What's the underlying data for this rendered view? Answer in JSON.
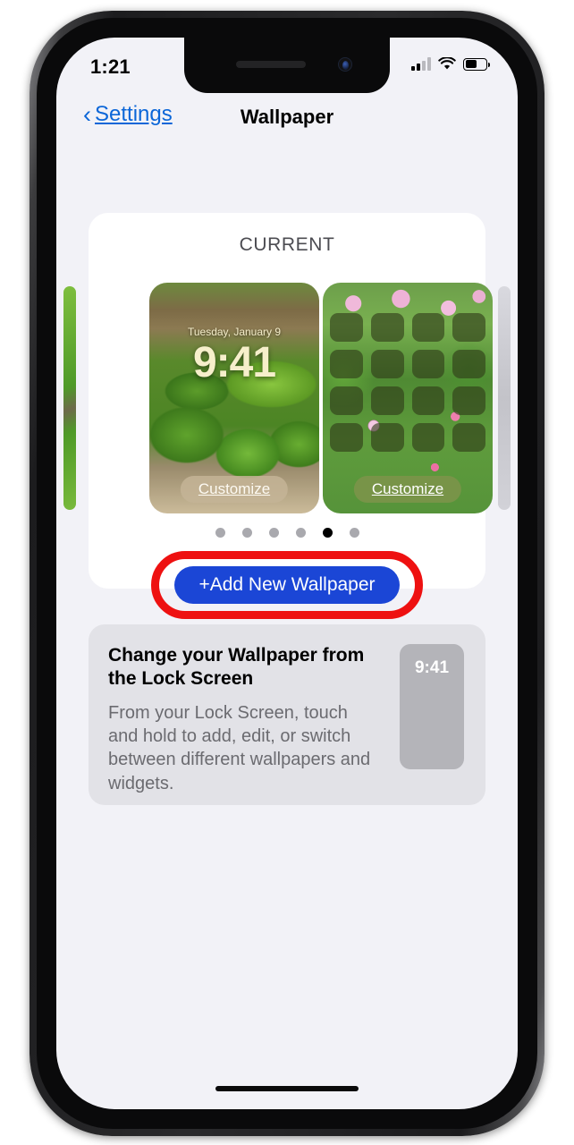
{
  "status_bar": {
    "time": "1:21",
    "cellular_bars_filled": 2,
    "cellular_bars_total": 4,
    "wifi_icon": "wifi-icon",
    "battery_level_percent": 48
  },
  "nav": {
    "back_label": "Settings",
    "back_icon": "chevron-left-icon",
    "title": "Wallpaper"
  },
  "current_section": {
    "label": "CURRENT",
    "lock_screen": {
      "date": "Tuesday, January 9",
      "time": "9:41",
      "customize_label": "Customize"
    },
    "home_screen": {
      "customize_label": "Customize",
      "app_icon_count": 16
    },
    "page_dots": {
      "count": 6,
      "active_index": 4
    },
    "add_button": {
      "label": "+Add New Wallpaper",
      "color": "#1b46d6",
      "annotation_ring_color": "#ee1111"
    }
  },
  "info_card": {
    "title": "Change your Wallpaper from the Lock Screen",
    "body": "From your Lock Screen, touch and hold to add, edit, or switch between different wallpapers and widgets.",
    "phone_thumb_time": "9:41"
  }
}
